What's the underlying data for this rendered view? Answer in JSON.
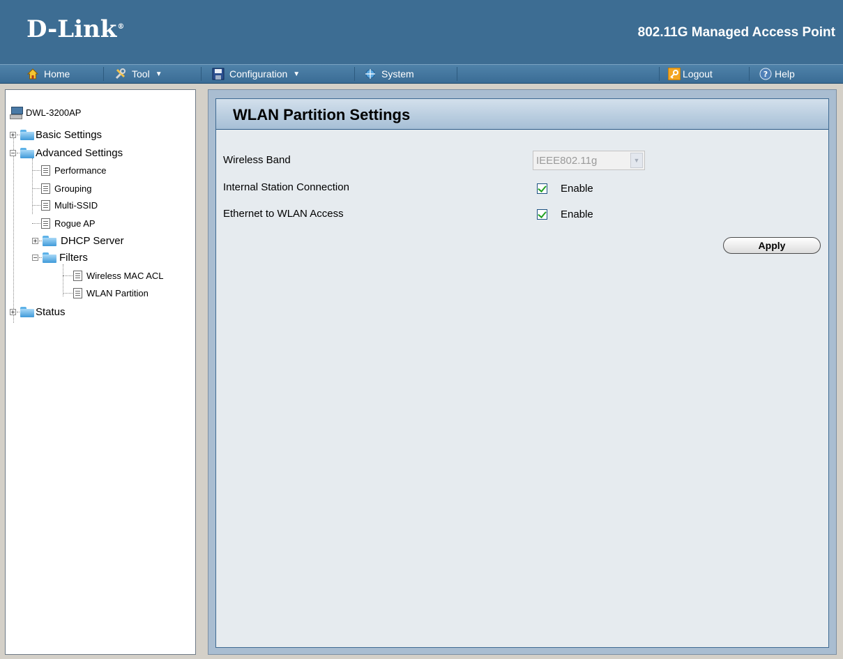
{
  "header": {
    "brand": "D-Link",
    "product": "802.11G Managed Access Point"
  },
  "menu": {
    "home": "Home",
    "tool": "Tool",
    "configuration": "Configuration",
    "system": "System",
    "logout": "Logout",
    "help": "Help"
  },
  "tree": {
    "root": "DWL-3200AP",
    "basic_settings": "Basic Settings",
    "advanced_settings": "Advanced Settings",
    "performance": "Performance",
    "grouping": "Grouping",
    "multi_ssid": "Multi-SSID",
    "rogue_ap": "Rogue AP",
    "dhcp_server": "DHCP Server",
    "filters": "Filters",
    "wireless_mac_acl": "Wireless MAC ACL",
    "wlan_partition": "WLAN Partition",
    "status": "Status"
  },
  "main": {
    "title": "WLAN Partition Settings",
    "wireless_band_label": "Wireless Band",
    "wireless_band_value": "IEEE802.11g",
    "internal_station_label": "Internal Station Connection",
    "internal_station_enable": "Enable",
    "internal_station_checked": true,
    "ethernet_wlan_label": "Ethernet to WLAN Access",
    "ethernet_wlan_enable": "Enable",
    "ethernet_wlan_checked": true,
    "apply_label": "Apply"
  },
  "colors": {
    "header_bg": "#3d6d93",
    "panel_bg": "#e6ebef",
    "accent_border": "#3f6a92"
  }
}
